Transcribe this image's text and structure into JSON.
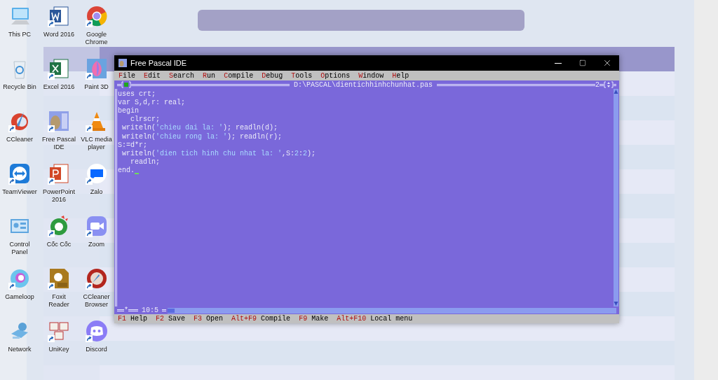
{
  "desktop": {
    "icons": [
      {
        "label": "This PC",
        "kind": "computer",
        "shortcut": false
      },
      {
        "label": "Recycle Bin",
        "kind": "recycle",
        "shortcut": false
      },
      {
        "label": "CCleaner",
        "kind": "ccleaner",
        "shortcut": true
      },
      {
        "label": "TeamViewer",
        "kind": "teamviewer",
        "shortcut": true
      },
      {
        "label": "Control Panel",
        "kind": "panel",
        "shortcut": false
      },
      {
        "label": "Gameloop",
        "kind": "gameloop",
        "shortcut": true
      },
      {
        "label": "Network",
        "kind": "network",
        "shortcut": false
      },
      {
        "label": "Word 2016",
        "kind": "word",
        "shortcut": true
      },
      {
        "label": "Excel 2016",
        "kind": "excel",
        "shortcut": true
      },
      {
        "label": "Free Pascal IDE",
        "kind": "fpc",
        "shortcut": true
      },
      {
        "label": "PowerPoint 2016",
        "kind": "powerpoint",
        "shortcut": true
      },
      {
        "label": "Cốc Cốc",
        "kind": "coccoc",
        "shortcut": true
      },
      {
        "label": "Foxit Reader",
        "kind": "foxit",
        "shortcut": true
      },
      {
        "label": "UniKey",
        "kind": "unikey",
        "shortcut": true
      },
      {
        "label": "Google Chrome",
        "kind": "chrome",
        "shortcut": true
      },
      {
        "label": "Paint 3D",
        "kind": "paint",
        "shortcut": true
      },
      {
        "label": "VLC media player",
        "kind": "vlc",
        "shortcut": true
      },
      {
        "label": "Zalo",
        "kind": "zalo",
        "shortcut": true
      },
      {
        "label": "Zoom",
        "kind": "zoom",
        "shortcut": true
      },
      {
        "label": "CCleaner Browser",
        "kind": "ccbrowser",
        "shortcut": true
      },
      {
        "label": "Discord",
        "kind": "discord",
        "shortcut": true
      }
    ]
  },
  "window": {
    "title": "Free Pascal IDE",
    "menu": [
      "File",
      "Edit",
      "Search",
      "Run",
      "Compile",
      "Debug",
      "Tools",
      "Options",
      "Window",
      "Help"
    ],
    "editor": {
      "file": "D:\\PASCAL\\dientichhinhchunhat.pas",
      "window_number": "2",
      "modified_mark": "*",
      "position": "10:5",
      "lines": [
        {
          "cursor": false,
          "segments": [
            {
              "kind": "code",
              "text": "uses crt;"
            }
          ]
        },
        {
          "cursor": false,
          "segments": [
            {
              "kind": "code",
              "text": "var S,d,r: real;"
            }
          ]
        },
        {
          "cursor": false,
          "segments": [
            {
              "kind": "code",
              "text": "begin"
            }
          ]
        },
        {
          "cursor": false,
          "segments": [
            {
              "kind": "code",
              "text": "   clrscr;"
            }
          ]
        },
        {
          "cursor": false,
          "segments": [
            {
              "kind": "code",
              "text": " writeln("
            },
            {
              "kind": "string",
              "text": "'chieu dai la: '"
            },
            {
              "kind": "code",
              "text": "); readln(d);"
            }
          ]
        },
        {
          "cursor": false,
          "segments": [
            {
              "kind": "code",
              "text": " writeln("
            },
            {
              "kind": "string",
              "text": "'chieu rong la: '"
            },
            {
              "kind": "code",
              "text": "); readln(r);"
            }
          ]
        },
        {
          "cursor": false,
          "segments": [
            {
              "kind": "code",
              "text": "S:=d*r;"
            }
          ]
        },
        {
          "cursor": false,
          "segments": [
            {
              "kind": "code",
              "text": " writeln("
            },
            {
              "kind": "string",
              "text": "'dien tich hinh chu nhat la: '"
            },
            {
              "kind": "code",
              "text": ",S:"
            },
            {
              "kind": "number",
              "text": "2"
            },
            {
              "kind": "code",
              "text": ":"
            },
            {
              "kind": "number",
              "text": "2"
            },
            {
              "kind": "code",
              "text": ");"
            }
          ]
        },
        {
          "cursor": false,
          "segments": [
            {
              "kind": "code",
              "text": "   readln;"
            }
          ]
        },
        {
          "cursor": true,
          "segments": [
            {
              "kind": "code",
              "text": "end."
            }
          ]
        }
      ]
    },
    "status_bar": [
      {
        "key": "F1",
        "label": "Help"
      },
      {
        "key": "F2",
        "label": "Save"
      },
      {
        "key": "F3",
        "label": "Open"
      },
      {
        "key": "Alt+F9",
        "label": "Compile"
      },
      {
        "key": "F9",
        "label": "Make"
      },
      {
        "key": "Alt+F10",
        "label": "Local menu"
      }
    ]
  }
}
